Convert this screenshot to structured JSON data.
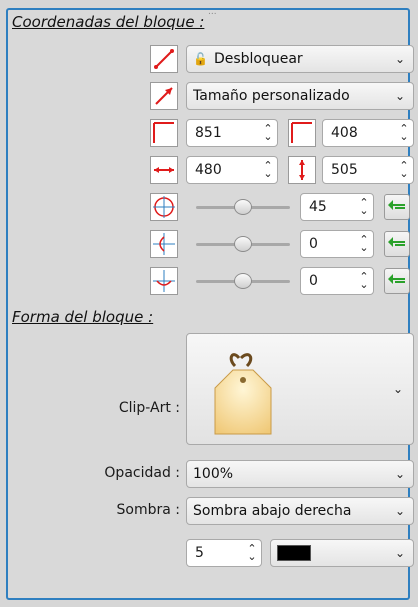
{
  "sections": {
    "coords_title": "Coordenadas del bloque :",
    "shape_title": "Forma del bloque :"
  },
  "lock": {
    "label": "Desbloquear",
    "icon": "lock-open-icon"
  },
  "size_mode": {
    "label": "Tamaño personalizado"
  },
  "position": {
    "x": "851",
    "y": "408"
  },
  "size": {
    "width": "480",
    "height": "505"
  },
  "rotation": {
    "value": "45",
    "slider": 0.5
  },
  "skew_h": {
    "value": "0",
    "slider": 0.5
  },
  "skew_v": {
    "value": "0",
    "slider": 0.5
  },
  "shape": {
    "clipart_label": "Clip-Art :",
    "opacity_label": "Opacidad :",
    "opacity_value": "100%",
    "shadow_label": "Sombra :",
    "shadow_value": "Sombra abajo derecha",
    "shadow_size": "5",
    "shadow_color": "#000000"
  },
  "colors": {
    "accent": "#2e7fc0",
    "icon_red": "#e01b1b",
    "apply_green": "#2aa12a"
  }
}
